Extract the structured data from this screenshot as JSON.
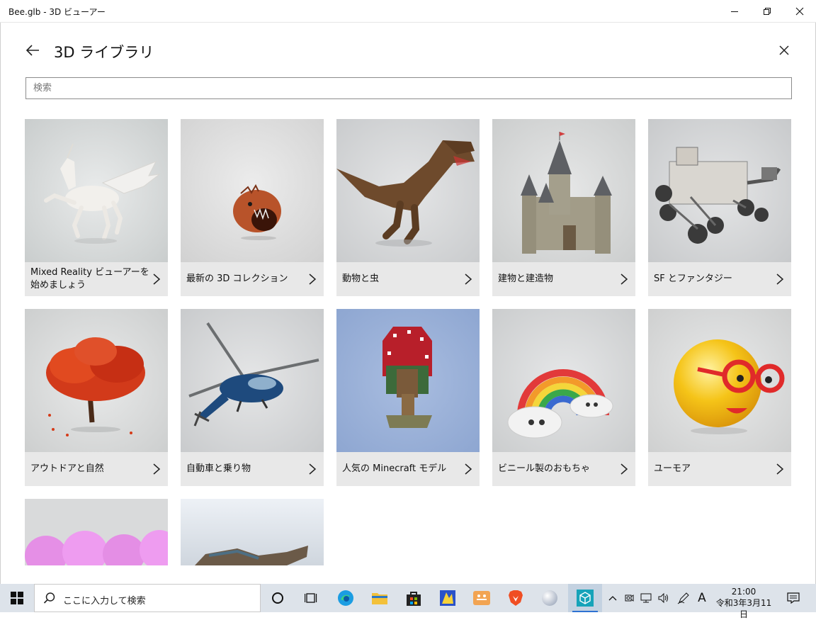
{
  "window": {
    "title": "Bee.glb - 3D ビューアー"
  },
  "library": {
    "title": "3D ライブラリ",
    "search_placeholder": "検索",
    "categories": [
      {
        "label": "Mixed Reality ビューアーを始めましょう"
      },
      {
        "label": "最新の 3D コレクション"
      },
      {
        "label": "動物と虫"
      },
      {
        "label": "建物と建造物"
      },
      {
        "label": "SF とファンタジー"
      },
      {
        "label": "アウトドアと自然"
      },
      {
        "label": "自動車と乗り物"
      },
      {
        "label": "人気の Minecraft モデル"
      },
      {
        "label": "ビニール製のおもちゃ"
      },
      {
        "label": "ユーモア"
      }
    ]
  },
  "taskbar": {
    "search_placeholder": "ここに入力して検索",
    "ime_label": "A",
    "time": "21:00",
    "date": "令和3年3月11日"
  },
  "colors": {
    "accent": "#2e72d2",
    "card_bg": "#e8e8e8",
    "taskbar_bg": "#dde3ea"
  }
}
